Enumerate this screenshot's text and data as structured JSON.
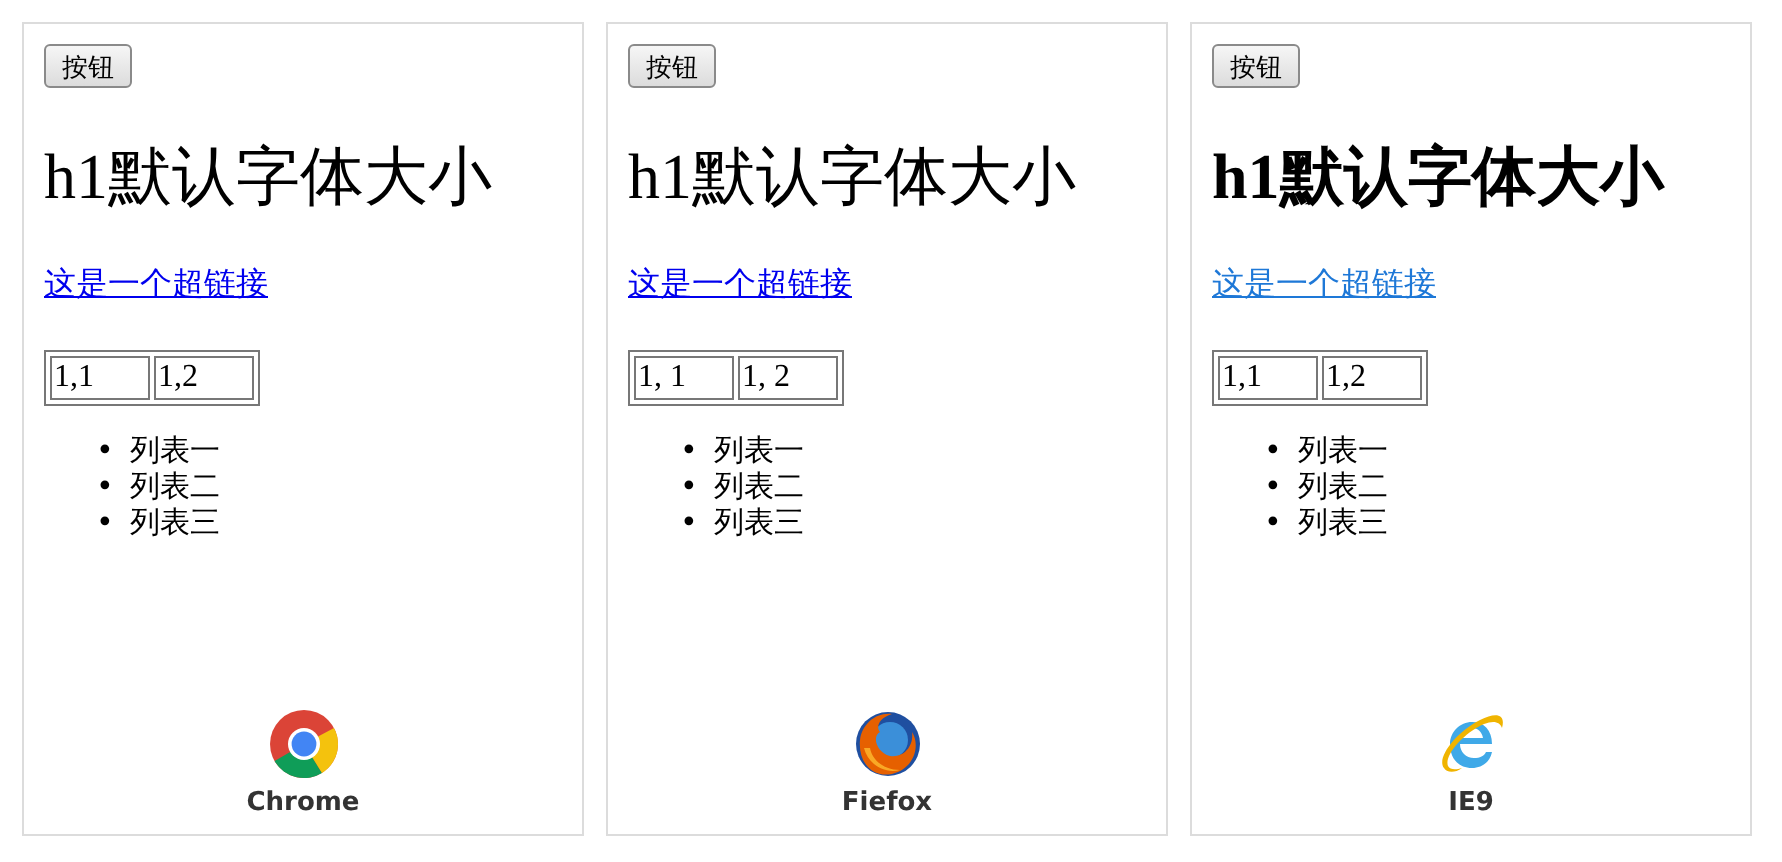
{
  "panels": [
    {
      "kind": "chrome",
      "button": "按钮",
      "heading": "h1默认字体大小",
      "heading_bold": false,
      "link": "这是一个超链接",
      "color": "#0000ee",
      "cells": [
        "1,1",
        "1,2"
      ],
      "bullet": "•",
      "list": [
        "列表一",
        "列表二",
        "列表三"
      ],
      "browser": "Chrome"
    },
    {
      "kind": "firefox",
      "button": "按钮",
      "heading": "h1默认字体大小",
      "heading_bold": false,
      "link": "这是一个超链接",
      "color": "#0000ee",
      "cells": [
        "1, 1",
        "1, 2"
      ],
      "bullet": "•",
      "list": [
        "列表一",
        "列表二",
        "列表三"
      ],
      "browser": "Fiefox"
    },
    {
      "kind": "ie",
      "button": "按钮",
      "heading": "h1默认字体大小",
      "heading_bold": true,
      "link": "这是一个超链接",
      "color": "#1e78d7",
      "cells": [
        "1,1",
        "1,2"
      ],
      "bullet": "•",
      "list": [
        "列表一",
        "列表二",
        "列表三"
      ],
      "browser": "IE9"
    }
  ]
}
